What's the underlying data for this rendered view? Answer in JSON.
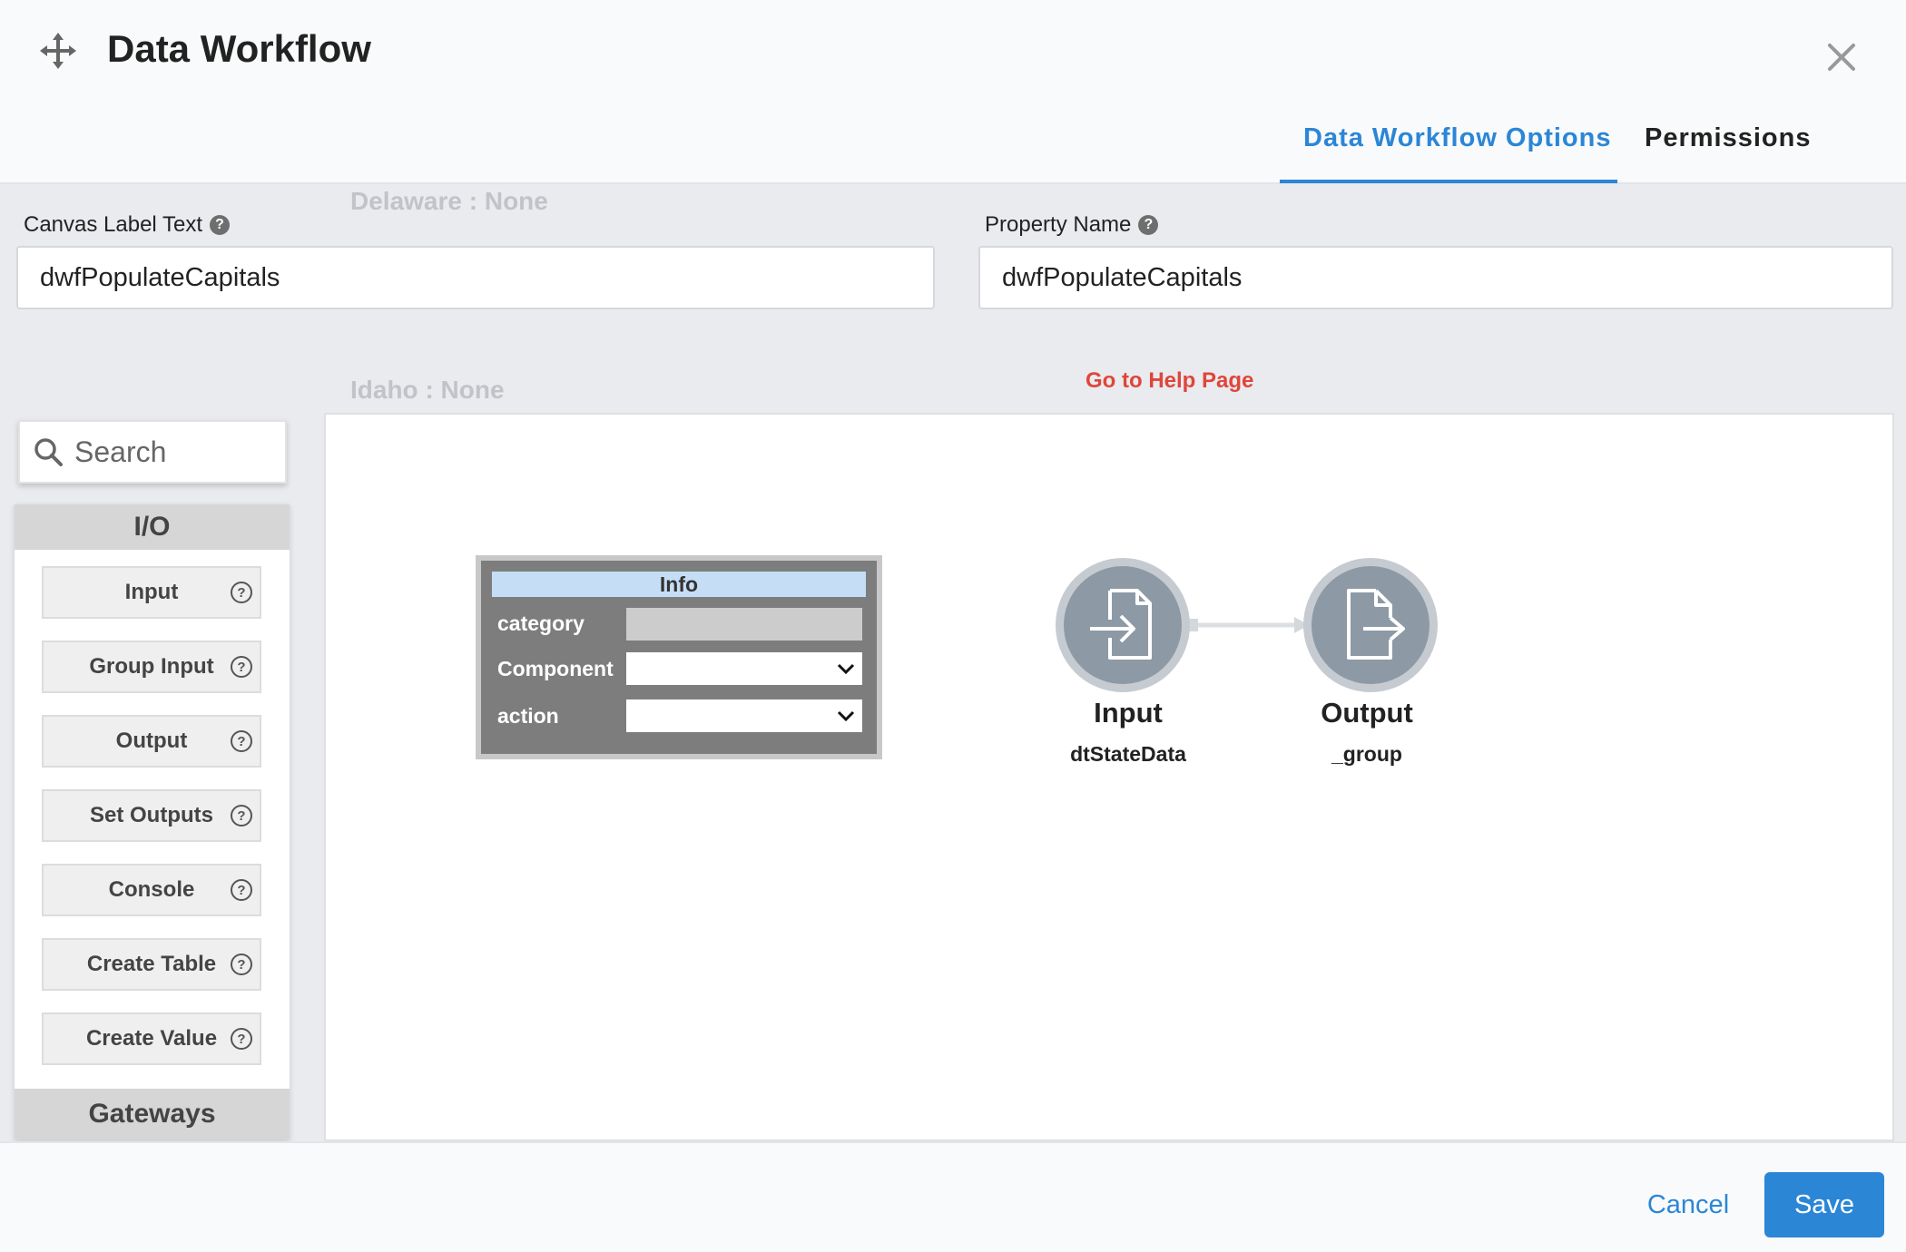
{
  "background": {
    "ghost_lines": [
      "Delaware : None",
      "Idaho : None"
    ]
  },
  "header": {
    "title": "Data Workflow",
    "tabs": [
      {
        "label": "Data Workflow Options",
        "active": true
      },
      {
        "label": "Permissions",
        "active": false
      }
    ]
  },
  "fields": {
    "canvas_label": {
      "label": "Canvas Label Text",
      "value": "dwfPopulateCapitals"
    },
    "property_name": {
      "label": "Property Name",
      "value": "dwfPopulateCapitals"
    }
  },
  "help_link": "Go to Help Page",
  "search": {
    "placeholder": "Search"
  },
  "palette": {
    "section": "I/O",
    "items": [
      "Input",
      "Group Input",
      "Output",
      "Set Outputs",
      "Console",
      "Create Table",
      "Create Value"
    ],
    "next_section": "Gateways"
  },
  "info_node": {
    "title": "Info",
    "rows": [
      {
        "label": "category",
        "value": ""
      },
      {
        "label": "Component",
        "value": ""
      },
      {
        "label": "action",
        "value": ""
      }
    ]
  },
  "nodes": [
    {
      "title": "Input",
      "subtitle": "dtStateData"
    },
    {
      "title": "Output",
      "subtitle": "_group"
    }
  ],
  "footer": {
    "cancel": "Cancel",
    "save": "Save"
  },
  "colors": {
    "accent": "#2b86d6",
    "link": "#e0453a",
    "node": "#8d9aa6"
  }
}
